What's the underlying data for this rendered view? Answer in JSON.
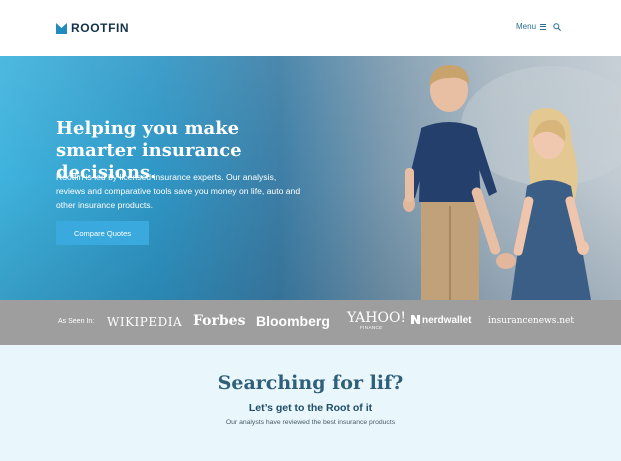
{
  "header": {
    "logo_text": "ROOTFIN",
    "menu_label": "Menu",
    "brand_color": "#12324a",
    "accent_color": "#2a6f92",
    "icons": [
      "hamburger-icon",
      "search-icon"
    ]
  },
  "hero": {
    "title": "Helping you make smarter insurance decisions.",
    "description": "Rootfin is led by licensed insurance experts. Our analysis, reviews and comparative tools save you money on life, auto and other insurance products.",
    "cta_label": "Compare Quotes",
    "cta_color": "#3aa9de"
  },
  "press": {
    "label": "As Seen In:",
    "logos": {
      "wikipedia": "WIKIPEDIA",
      "forbes": "Forbes",
      "bloomberg": "Bloomberg",
      "yahoo": "YAHOO!",
      "yahoo_sub": "FINANCE",
      "nerdwallet": "nerdwallet",
      "insurancenews": "insurancenews.net"
    }
  },
  "search_section": {
    "title": "Searching for lif?",
    "subtitle": "Let’s get to the Root of it",
    "note": "Our analysts have reviewed the best insurance products"
  }
}
